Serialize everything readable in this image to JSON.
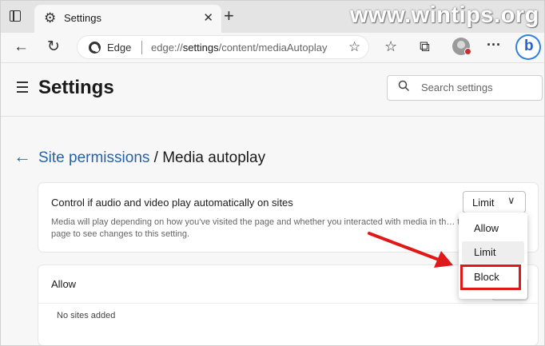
{
  "browser": {
    "tab_title": "Settings",
    "tab_close": "✕",
    "new_tab": "+",
    "watermark": "www.wintips.org",
    "site_label": "Edge",
    "url_prefix": "edge://",
    "url_bold": "settings",
    "url_rest": "/content/mediaAutoplay"
  },
  "icons": {
    "back": "←",
    "refresh": "↻",
    "gear": "⚙",
    "favorite": "☆",
    "favorites_bar": "☆",
    "collections": "⧉",
    "more": "···",
    "search": "⚲",
    "bing": "b"
  },
  "settings": {
    "title": "Settings",
    "search_placeholder": "Search settings"
  },
  "page": {
    "breadcrumb_link": "Site permissions",
    "breadcrumb_sep": " / ",
    "breadcrumb_current": "Media autoplay",
    "back_arrow": "←"
  },
  "control_card": {
    "heading": "Control if audio and video play automatically on sites",
    "description": "Media will play depending on how you've visited the page and whether you interacted with media in th… the page to see changes to this setting.",
    "dropdown_value": "Limit",
    "dropdown_chevron": "∨"
  },
  "dropdown_menu": {
    "options": [
      "Allow",
      "Limit",
      "Block"
    ],
    "selected": "Limit",
    "highlighted": "Block",
    "highlight_color": "#e01818"
  },
  "allow_card": {
    "heading": "Allow",
    "empty_text": "No sites added"
  }
}
